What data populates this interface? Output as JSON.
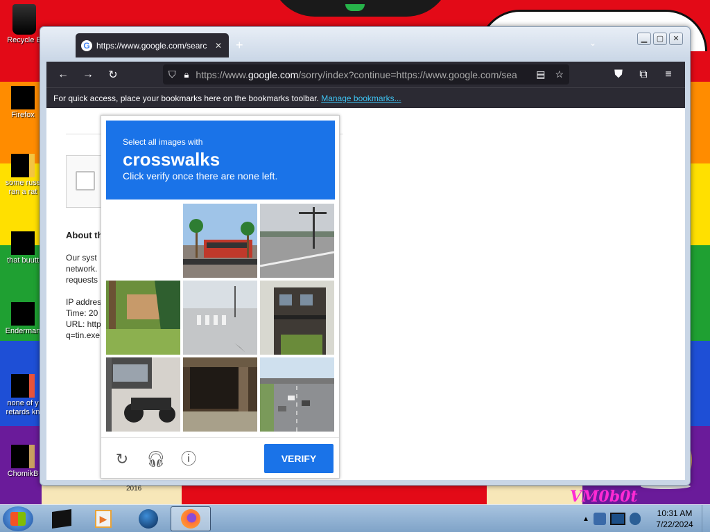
{
  "desktop": {
    "icons": [
      {
        "label": "Recycle B"
      },
      {
        "label": "Firefox"
      },
      {
        "label": "some russ",
        "label2": "ran a rat"
      },
      {
        "label": "that buutt"
      },
      {
        "label": "Enderman"
      },
      {
        "label": "none of y",
        "label2": "retards kn"
      },
      {
        "label": "ChomikB"
      }
    ],
    "wallpaper_year": "2016",
    "wallpaper_signature": "VM0b0t"
  },
  "browser": {
    "tab_title": "https://www.google.com/searc",
    "url_prefix": "https://www.",
    "url_domain": "google.com",
    "url_rest": "/sorry/index?continue=https://www.google.com/sea",
    "bookmarks_text": "For quick access, place your bookmarks here on the bookmarks toolbar.",
    "bookmarks_link": "Manage bookmarks..."
  },
  "page": {
    "about_heading": "About th",
    "body_lines": "Our syst\nnetwork.\nrequests\n\nIP addres\nTime: 20\nURL: http\nq=tin.exe"
  },
  "captcha": {
    "instruction_small": "Select all images with",
    "target": "crosswalks",
    "instruction_sub": "Click verify once there are none left.",
    "verify_label": "VERIFY",
    "tiles": [
      {
        "name": "blank"
      },
      {
        "name": "bus-palm-trees"
      },
      {
        "name": "street-intersection"
      },
      {
        "name": "house-tree"
      },
      {
        "name": "crosswalk-street"
      },
      {
        "name": "building"
      },
      {
        "name": "motorcycle-car"
      },
      {
        "name": "porch"
      },
      {
        "name": "highway-cars"
      }
    ]
  },
  "taskbar": {
    "time": "10:31 AM",
    "date": "7/22/2024"
  }
}
